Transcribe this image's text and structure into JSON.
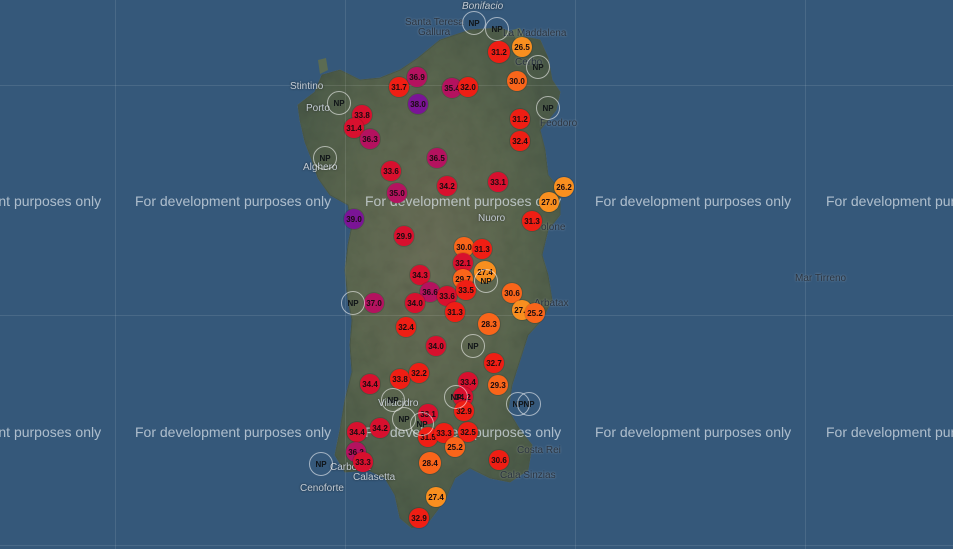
{
  "map": {
    "watermark": "For development purposes only",
    "places": [
      {
        "name": "Bonifacio",
        "style": "italic"
      },
      {
        "name": "Santa Teresa",
        "style": "dark"
      },
      {
        "name": "Gallura",
        "style": "dark"
      },
      {
        "name": "La Maddalena",
        "style": "dark"
      },
      {
        "name": "Stintino",
        "style": "light"
      },
      {
        "name": "Porto",
        "style": "light"
      },
      {
        "name": "Alghero",
        "style": "light"
      },
      {
        "name": "Nuoro",
        "style": "light"
      },
      {
        "name": "Mar Tirreno",
        "style": "dark"
      },
      {
        "name": "Arbatax",
        "style": "dark"
      },
      {
        "name": "Carbonia",
        "style": "light"
      },
      {
        "name": "Calasetta",
        "style": "light"
      },
      {
        "name": "Cerbo",
        "style": "dark"
      },
      {
        "name": "Feodoro",
        "style": "dark"
      },
      {
        "name": "olone",
        "style": "dark"
      },
      {
        "name": "Villacidro",
        "style": "light"
      },
      {
        "name": "Costa Rei",
        "style": "dark"
      },
      {
        "name": "Cala Sinzias",
        "style": "dark"
      },
      {
        "name": "Cenoforte",
        "style": "light"
      }
    ],
    "np_label": "NP",
    "colors": {
      "purple": "#7a1496",
      "magenta": "#b4125f",
      "crimson": "#d8102e",
      "red": "#ef1e14",
      "orange": "#f9651a",
      "amber": "#f98f1f"
    },
    "markers": [
      {
        "label": "31.2",
        "color": "red"
      },
      {
        "label": "26.5",
        "color": "amber"
      },
      {
        "label": "30.0",
        "color": "orange"
      },
      {
        "label": "31.7",
        "color": "red"
      },
      {
        "label": "36.9",
        "color": "magenta"
      },
      {
        "label": "35.4",
        "color": "magenta"
      },
      {
        "label": "32.0",
        "color": "red"
      },
      {
        "label": "38.0",
        "color": "purple"
      },
      {
        "label": "33.8",
        "color": "crimson"
      },
      {
        "label": "31.4",
        "color": "crimson"
      },
      {
        "label": "36.3",
        "color": "magenta"
      },
      {
        "label": "31.2",
        "color": "red"
      },
      {
        "label": "32.4",
        "color": "red"
      },
      {
        "label": "36.5",
        "color": "magenta"
      },
      {
        "label": "33.6",
        "color": "crimson"
      },
      {
        "label": "33.1",
        "color": "crimson"
      },
      {
        "label": "34.2",
        "color": "crimson"
      },
      {
        "label": "26.2",
        "color": "amber"
      },
      {
        "label": "35.0",
        "color": "magenta"
      },
      {
        "label": "27.0",
        "color": "amber"
      },
      {
        "label": "39.0",
        "color": "purple"
      },
      {
        "label": "31.3",
        "color": "red"
      },
      {
        "label": "29.9",
        "color": "crimson"
      },
      {
        "label": "30.0",
        "color": "orange"
      },
      {
        "label": "31.3",
        "color": "red"
      },
      {
        "label": "32.1",
        "color": "crimson"
      },
      {
        "label": "27.4",
        "color": "amber"
      },
      {
        "label": "34.3",
        "color": "crimson"
      },
      {
        "label": "29.7",
        "color": "orange"
      },
      {
        "label": "36.6",
        "color": "magenta"
      },
      {
        "label": "33.6",
        "color": "crimson"
      },
      {
        "label": "33.5",
        "color": "red"
      },
      {
        "label": "30.6",
        "color": "orange"
      },
      {
        "label": "37.0",
        "color": "magenta"
      },
      {
        "label": "34.0",
        "color": "crimson"
      },
      {
        "label": "31.3",
        "color": "red"
      },
      {
        "label": "27.4",
        "color": "amber"
      },
      {
        "label": "25.2",
        "color": "orange"
      },
      {
        "label": "32.4",
        "color": "red"
      },
      {
        "label": "28.3",
        "color": "orange"
      },
      {
        "label": "34.0",
        "color": "crimson"
      },
      {
        "label": "32.7",
        "color": "red"
      },
      {
        "label": "34.4",
        "color": "crimson"
      },
      {
        "label": "33.8",
        "color": "red"
      },
      {
        "label": "32.2",
        "color": "red"
      },
      {
        "label": "33.4",
        "color": "crimson"
      },
      {
        "label": "29.3",
        "color": "orange"
      },
      {
        "label": "34.2",
        "color": "crimson"
      },
      {
        "label": "32.9",
        "color": "red"
      },
      {
        "label": "33.1",
        "color": "crimson"
      },
      {
        "label": "34.4",
        "color": "crimson"
      },
      {
        "label": "34.2",
        "color": "crimson"
      },
      {
        "label": "31.5",
        "color": "red"
      },
      {
        "label": "33.3",
        "color": "red"
      },
      {
        "label": "32.5",
        "color": "red"
      },
      {
        "label": "36.2",
        "color": "magenta"
      },
      {
        "label": "25.2",
        "color": "orange"
      },
      {
        "label": "33.3",
        "color": "crimson"
      },
      {
        "label": "28.4",
        "color": "orange"
      },
      {
        "label": "30.6",
        "color": "red"
      },
      {
        "label": "27.4",
        "color": "amber"
      },
      {
        "label": "32.9",
        "color": "red"
      }
    ]
  }
}
